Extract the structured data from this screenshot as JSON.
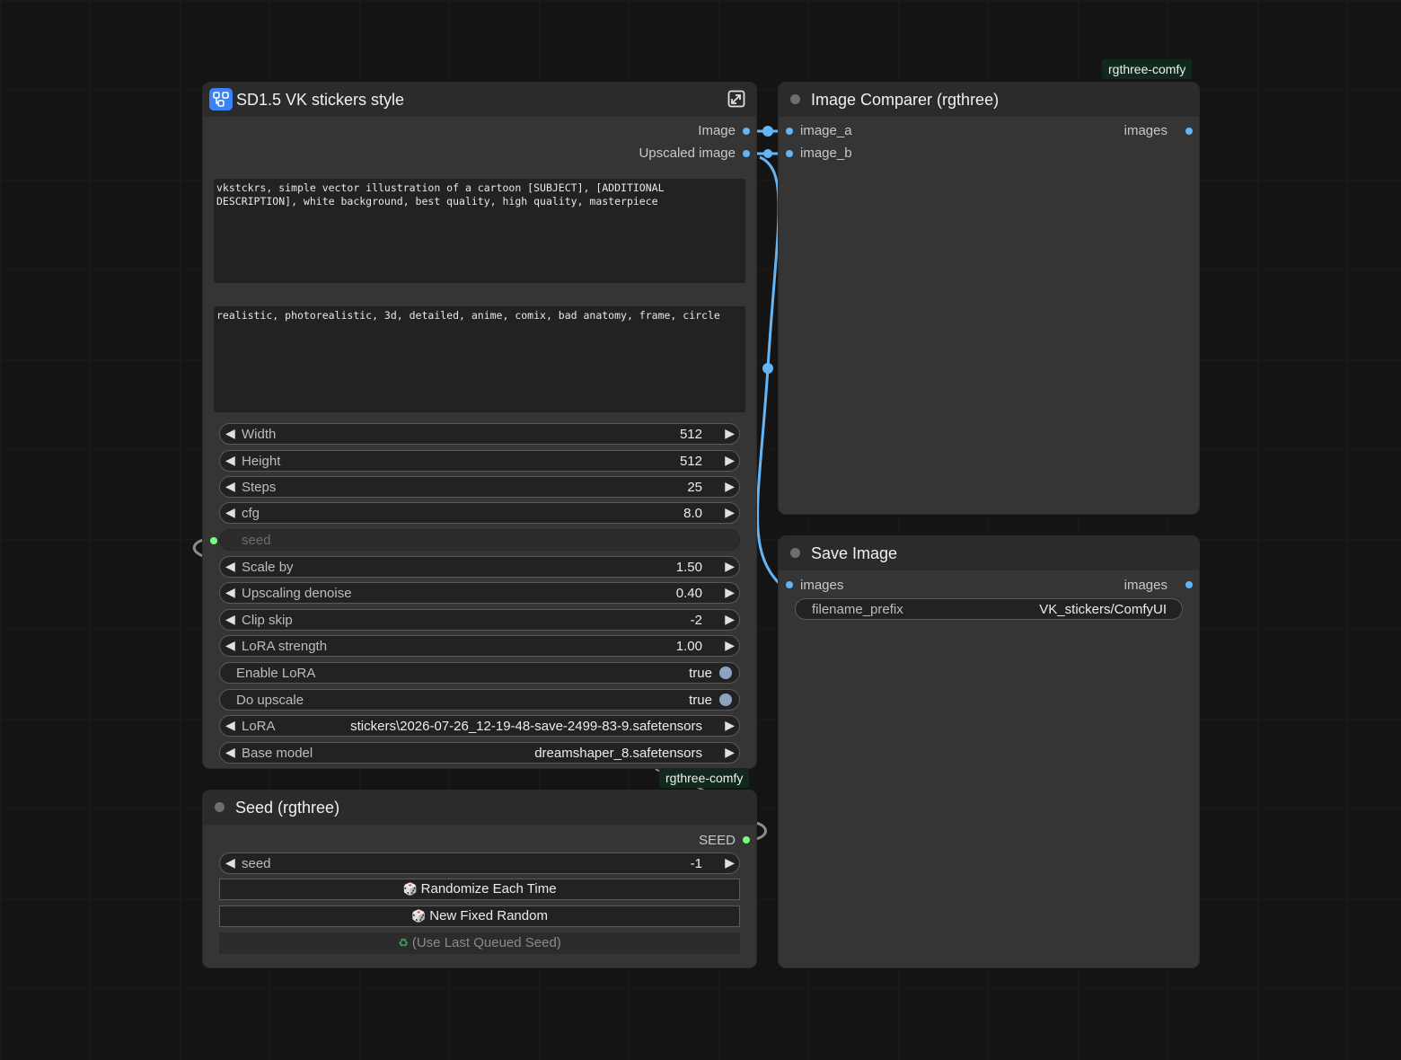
{
  "sd_node": {
    "title": "SD1.5 VK stickers style",
    "outputs": [
      "Image",
      "Upscaled image"
    ],
    "positive_prompt": "vkstckrs, simple vector illustration of a cartoon [SUBJECT], [ADDITIONAL DESCRIPTION], white background, best quality, high quality, masterpiece",
    "negative_prompt": "realistic, photorealistic, 3d, detailed, anime, comix, bad anatomy, frame, circle",
    "widgets": {
      "width": {
        "label": "Width",
        "value": "512"
      },
      "height": {
        "label": "Height",
        "value": "512"
      },
      "steps": {
        "label": "Steps",
        "value": "25"
      },
      "cfg": {
        "label": "cfg",
        "value": "8.0"
      },
      "seed": {
        "label": "seed"
      },
      "scale_by": {
        "label": "Scale by",
        "value": "1.50"
      },
      "upscaling_denoise": {
        "label": "Upscaling denoise",
        "value": "0.40"
      },
      "clip_skip": {
        "label": "Clip skip",
        "value": "-2"
      },
      "lora_strength": {
        "label": "LoRA strength",
        "value": "1.00"
      },
      "enable_lora": {
        "label": "Enable LoRA",
        "value": "true"
      },
      "do_upscale": {
        "label": "Do upscale",
        "value": "true"
      },
      "lora": {
        "label": "LoRA",
        "value": "stickers\\2026-07-26_12-19-48-save-2499-83-9.safetensors"
      },
      "base_model": {
        "label": "Base model",
        "value": "dreamshaper_8.safetensors"
      }
    },
    "badge": "rgthree-comfy"
  },
  "comparer_node": {
    "title": "Image Comparer (rgthree)",
    "inputs": [
      "image_a",
      "image_b"
    ],
    "output": "images",
    "badge": "rgthree-comfy"
  },
  "save_node": {
    "title": "Save Image",
    "input": "images",
    "output": "images",
    "filename_prefix": {
      "label": "filename_prefix",
      "value": "VK_stickers/ComfyUI"
    }
  },
  "seed_node": {
    "title": "Seed (rgthree)",
    "output": "SEED",
    "seed": {
      "label": "seed",
      "value": "-1"
    },
    "buttons": {
      "randomize": "Randomize Each Time",
      "new_fixed": "New Fixed Random",
      "use_last": "(Use Last Queued Seed)"
    }
  },
  "colors": {
    "link_image": "#64b5f6",
    "link_seed": "#7cfc7c",
    "badge_bg": "#10291c"
  },
  "icons": [
    "workflow-icon",
    "expand-icon",
    "dice-icon",
    "recycle-icon"
  ]
}
